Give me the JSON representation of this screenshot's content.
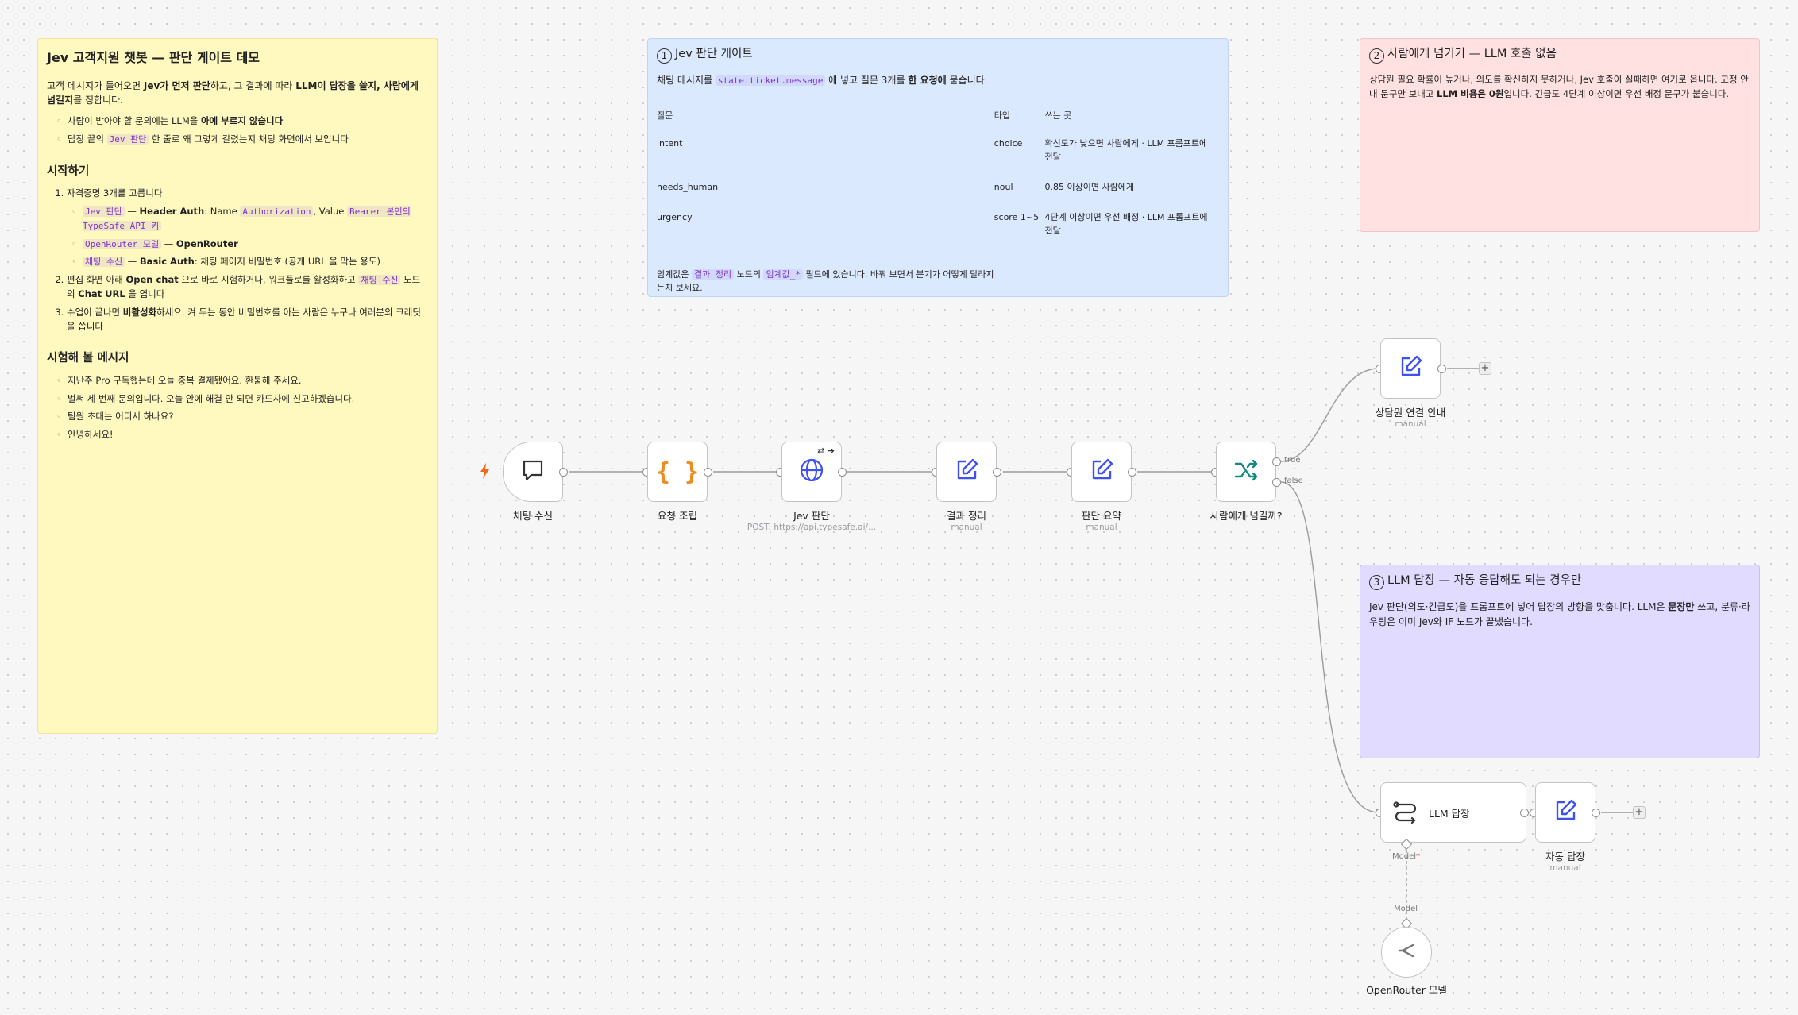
{
  "notes": {
    "main": {
      "title": "Jev 고객지원 챗봇 — 판단 게이트 데모",
      "intro_a": "고객 메시지가 들어오면 ",
      "intro_b": "Jev가 먼저 판단",
      "intro_c": "하고, 그 결과에 따라 ",
      "intro_d": "LLM이 답장을 쓸지, 사람에게 넘길지",
      "intro_e": "를 정합니다.",
      "bullet1_a": "사람이 받아야 할 문의에는 LLM을 ",
      "bullet1_b": "아예 부르지 않습니다",
      "bullet2_a": "답장 끝의 ",
      "bullet2_code": "Jev 판단",
      "bullet2_b": " 한 줄로 왜 그렇게 갈렸는지 채팅 화면에서 보입니다",
      "start_heading": "시작하기",
      "step1": "자격증명 3개를 고릅니다",
      "cred1_code": "Jev 판단",
      "cred1_a": " — ",
      "cred1_b": "Header Auth",
      "cred1_c": ": Name ",
      "cred1_code2": "Authorization",
      "cred1_d": ", Value ",
      "cred1_code3": "Bearer 본인의 TypeSafe API 키",
      "cred2_code": "OpenRouter 모델",
      "cred2_a": " — ",
      "cred2_b": "OpenRouter",
      "cred3_code": "채팅 수신",
      "cred3_a": " — ",
      "cred3_b": "Basic Auth",
      "cred3_c": ": 채팅 페이지 비밀번호 (공개 URL 을 막는 용도)",
      "step2_a": "편집 화면 아래 ",
      "step2_b": "Open chat",
      "step2_c": " 으로 바로 시험하거나, 워크플로를 활성화하고 ",
      "step2_code": "채팅 수신",
      "step2_d": " 노드의 ",
      "step2_e": "Chat URL",
      "step2_f": " 을 엽니다",
      "step3_a": "수업이 끝나면 ",
      "step3_b": "비활성화",
      "step3_c": "하세요. 켜 두는 동안 비밀번호를 아는 사람은 누구나 여러분의 크레딧을 씁니다",
      "try_heading": "시험해 볼 메시지",
      "try": [
        "지난주 Pro 구독했는데 오늘 중복 결제됐어요. 환불해 주세요.",
        "벌써 세 번째 문의입니다. 오늘 안에 해결 안 되면 카드사에 신고하겠습니다.",
        "팀원 초대는 어디서 하나요?",
        "안녕하세요!"
      ]
    },
    "gate": {
      "num": "1",
      "title": "Jev 판단 게이트",
      "desc_a": "채팅 메시지를 ",
      "desc_code": "state.ticket.message",
      "desc_b": " 에 넣고 질문 3개를 ",
      "desc_c": "한 요청에",
      "desc_d": " 묻습니다.",
      "headers": [
        "질문",
        "타입",
        "쓰는 곳"
      ],
      "rows": [
        [
          "intent",
          "choice",
          "확신도가 낮으면 사람에게 · LLM 프롬프트에 전달"
        ],
        [
          "needs_human",
          "noul",
          "0.85 이상이면 사람에게"
        ],
        [
          "urgency",
          "score 1~5",
          "4단계 이상이면 우선 배정 · LLM 프롬프트에 전달"
        ]
      ],
      "foot_a": "임계값은 ",
      "foot_code1": "결과 정리",
      "foot_b": " 노드의 ",
      "foot_code2": "임계값_*",
      "foot_c": " 필드에 있습니다. 바꿔 보면서 분기가 어떻게 달라지는지 보세요."
    },
    "human": {
      "num": "2",
      "title": "사람에게 넘기기 — LLM 호출 없음",
      "body_a": "상담원 필요 확률이 높거나, 의도를 확신하지 못하거나, Jev 호출이 실패하면 여기로 옵니다. 고정 안내 문구만 보내고 ",
      "body_b": "LLM 비용은 0원",
      "body_c": "입니다. 긴급도 4단계 이상이면 우선 배정 문구가 붙습니다."
    },
    "llm": {
      "num": "3",
      "title": "LLM 답장 — 자동 응답해도 되는 경우만",
      "body_a": "Jev 판단(의도·긴급도)을 프롬프트에 넣어 답장의 방향을 맞춥니다. LLM은 ",
      "body_b": "문장만",
      "body_c": " 쓰고, 분류·라우팅은 이미 Jev와 IF 노드가 끝냈습니다."
    }
  },
  "nodes": {
    "chat": {
      "label": "채팅 수신",
      "icon": "chat-bubble-icon"
    },
    "request": {
      "label": "요청 조립",
      "icon": "braces-icon",
      "color": "#f08c1f"
    },
    "jev": {
      "label": "Jev 판단",
      "sub": "POST: https://api.typesafe.ai/...",
      "icon": "globe-icon"
    },
    "result": {
      "label": "결과 정리",
      "sub": "manual",
      "icon": "edit-icon"
    },
    "summary": {
      "label": "판단 요약",
      "sub": "manual",
      "icon": "edit-icon"
    },
    "ifnode": {
      "label": "사람에게 넘길까?",
      "icon": "split-icon",
      "true_label": "true",
      "false_label": "false"
    },
    "agent_guide": {
      "label": "상담원 연결 안내",
      "sub": "manual",
      "icon": "edit-icon"
    },
    "llm": {
      "label": "LLM 답장",
      "icon": "agent-icon",
      "model_port": "Model"
    },
    "auto": {
      "label": "자동 답장",
      "sub": "manual",
      "icon": "edit-icon"
    },
    "openrouter": {
      "label": "OpenRouter 모델",
      "port_label": "Model",
      "icon": "openrouter-icon"
    }
  },
  "colors": {
    "accent": "#3f51f5",
    "trigger_bolt": "#f26b1d",
    "if_icon": "#128a7d"
  }
}
